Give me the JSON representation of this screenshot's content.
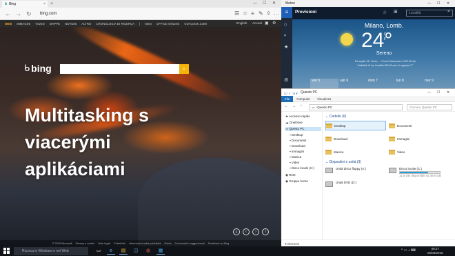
{
  "edge": {
    "tab_title": "Bing",
    "tab_close": "×",
    "new_tab": "+",
    "window_controls": [
      "—",
      "☐",
      "✕"
    ],
    "address": "bing.com",
    "nav": [
      "←",
      "→",
      "↻"
    ],
    "toolbar_icons": [
      "reading-view-icon",
      "favorite-star-icon",
      "hub-icon",
      "note-icon",
      "share-icon",
      "more-icon"
    ],
    "toolbar_glyphs": [
      "☰",
      "☆",
      "≡",
      "✎",
      "⇪",
      "…"
    ],
    "bing_nav": [
      "WEB",
      "IMMAGINI",
      "VIDEO",
      "MAPPE",
      "NOTIZIE",
      "ALTRO",
      "CRONOLOGIA DI RICERCA",
      "|",
      "MSN",
      "OFFICE ONLINE",
      "OUTLOOK.COM"
    ],
    "bing_right": [
      "English",
      "Accedi"
    ],
    "brand": "bing",
    "headline": "Multitasking s viacerými aplikáciami",
    "footer_links": [
      "© 2015 Microsoft",
      "Privacy e cookie",
      "Note legali",
      "Pubblicità",
      "Informazioni sulla pubblicità",
      "Guida",
      "Commenti e suggerimenti",
      "Feedback su Bing"
    ]
  },
  "meteo": {
    "window_title": "Meteo",
    "window_controls": [
      "—",
      "☐",
      "✕"
    ],
    "header": "Previsioni",
    "search_placeholder": "Località",
    "city": "Milano, Lomb.",
    "temperature": "24°",
    "unit_c": "C",
    "unit_f": "F",
    "condition": "Sereno",
    "details_line1": "Percepita 24°   Vento → 9 km/h   Barometro 1023.00 mb",
    "details_line2": "Visibilità 10 km   Umidità 65%   Punto di rugiada 17°",
    "days": [
      "ven 5",
      "sab 6",
      "dom 7",
      "lun 8",
      "mar 9"
    ],
    "sidebar_glyphs": [
      "≡",
      "⌂",
      "◐",
      "★",
      "⚙"
    ]
  },
  "explorer": {
    "title": "Questo PC",
    "quick_access": "◱ ✓ ⇲ ▾",
    "window_controls": [
      "—",
      "☐",
      "✕"
    ],
    "ribbon": [
      "File",
      "Computer",
      "Visualizza"
    ],
    "nav_arrows": "← → ↑",
    "address": "Questo PC",
    "search_placeholder": "Cerca in Questo PC",
    "sidebar": [
      "Accesso rapido",
      "OneDrive",
      "Questo PC",
      "Desktop",
      "Documenti",
      "Download",
      "Immagini",
      "Musica",
      "Video",
      "Disco locale (C:)",
      "Rete",
      "Gruppo home"
    ],
    "folders_header": "Cartelle (6)",
    "folders": [
      "Desktop",
      "Documenti",
      "Download",
      "Immagini",
      "Musica",
      "Video"
    ],
    "devices_header": "Dispositivi e unità (3)",
    "devices": [
      {
        "name": "Unità disco floppy (A:)",
        "free": ""
      },
      {
        "name": "Disco locale (C:)",
        "free": "11,5 GB disponibili su 39,6 GB",
        "used_fraction": 0.71
      },
      {
        "name": "Unità DVD (D:)",
        "free": ""
      }
    ],
    "status": "9 elementi"
  },
  "taskbar": {
    "search_placeholder": "Ricerca in Windows e nel Web",
    "app_glyphs": [
      "▭",
      "e",
      "▤",
      "◫",
      "◍",
      "▦"
    ],
    "tray": "^  ▭  ♪  ⌨",
    "time": "08:27",
    "date": "05/06/2015"
  }
}
